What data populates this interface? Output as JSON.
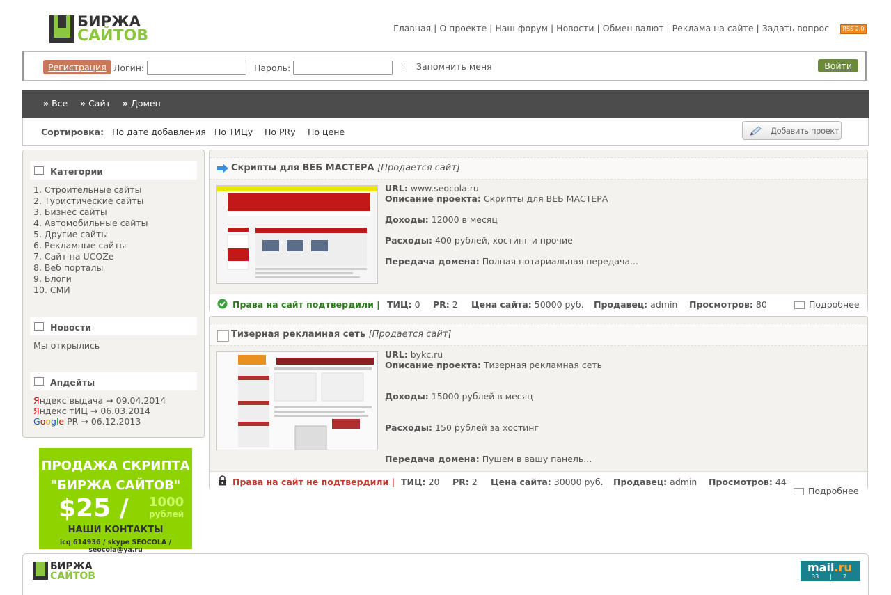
{
  "logo": {
    "line1": "БИРЖА",
    "line2": "САЙТОВ"
  },
  "topnav": [
    "Главная",
    "О проекте",
    "Наш форум",
    "Новости",
    "Обмен валют",
    "Реклама на сайте",
    "Задать вопрос"
  ],
  "rss_label": "RSS 2.0",
  "login": {
    "register": "Регистрация",
    "login_label": "Логин:",
    "login_value": "",
    "password_label": "Пароль:",
    "password_value": "",
    "remember": "Запомнить меня",
    "submit": "Войти"
  },
  "menu": [
    "Все",
    "Сайт",
    "Домен"
  ],
  "sort": {
    "label": "Сортировка:",
    "options": [
      "По дате добавления",
      "По ТИЦу",
      "По PRу",
      "По цене"
    ],
    "add_project": "Добавить проект"
  },
  "sidebar": {
    "categories_title": "Категории",
    "categories": [
      "1. Строительные сайты",
      "2. Туристические сайты",
      "3. Бизнес сайты",
      "4. Автомобильные сайты",
      "5. Другие сайты",
      "6. Рекламные сайты",
      "7. Сайт на UCOZe",
      "8. Веб порталы",
      "9. Блоги",
      "10. СМИ"
    ],
    "news_title": "Новости",
    "news": [
      "Мы открылись"
    ],
    "updates_title": "Апдейты",
    "updates": [
      {
        "first": "Я",
        "rest": "ндекс выдача",
        "date": "→ 09.04.2014"
      },
      {
        "first": "Я",
        "rest": "ндекс тИЦ",
        "date": "→ 06.03.2014"
      },
      {
        "first": "",
        "rest": " PR",
        "date": "→ 06.12.2013"
      }
    ],
    "google": "Google"
  },
  "promo": {
    "line1": "ПРОДАЖА СКРИПТА",
    "line2": "\"БИРЖА САЙТОВ\"",
    "price": "$25 /",
    "price_rub_num": "1000",
    "price_rub": "рублей",
    "contacts": "НАШИ КОНТАКТЫ",
    "details": "icq 614936 /  skype SEOCOLA /  seocola@ya.ru"
  },
  "labels": {
    "url": "URL:",
    "description": "Описание проекта:",
    "income": "Доходы:",
    "expenses": "Расходы:",
    "domain_transfer": "Передача домена:",
    "tic": "ТИЦ:",
    "pr": "PR:",
    "price": "Цена сайта:",
    "seller": "Продавец:",
    "views": "Просмотров:",
    "more": "Подробнее"
  },
  "listings": [
    {
      "title": "Скрипты для ВЕБ МАСТЕРА",
      "status": "[Продается сайт]",
      "url": "www.seocola.ru",
      "description": "Скрипты для ВЕБ МАСТЕРА",
      "income": "12000 в месяц",
      "expenses": "400 рублей, хостинг и прочие",
      "domain_transfer": "Полная нотариальная передача...",
      "rights": "Права на сайт подтвердили |",
      "tic": "0",
      "pr": "2",
      "price": "50000 руб.",
      "seller": "admin",
      "views": "80"
    },
    {
      "title": "Тизерная рекламная сеть",
      "status": "[Продается сайт]",
      "url": "bykc.ru",
      "description": "Тизерная рекламная сеть",
      "income": "15000 рублей в месяц",
      "expenses": "150 рублей за хостинг",
      "domain_transfer": "Пушем в вашу панель...",
      "rights": "Права на сайт не подтвердили |",
      "tic": "20",
      "pr": "2",
      "price": "30000 руб.",
      "seller": "admin",
      "views": "44"
    }
  ],
  "footer": {
    "logo1": "БИРЖА",
    "logo2": "САЙТОВ",
    "counter_brand": "mail",
    "counter_dot": ".ru",
    "counter_a": "33",
    "counter_b": "2"
  },
  "colors": {
    "accent_green": "#8cc63f",
    "dark_menu": "#4c4c4c",
    "confirmed": "#2e7d1e",
    "not_confirmed": "#c0392b"
  }
}
